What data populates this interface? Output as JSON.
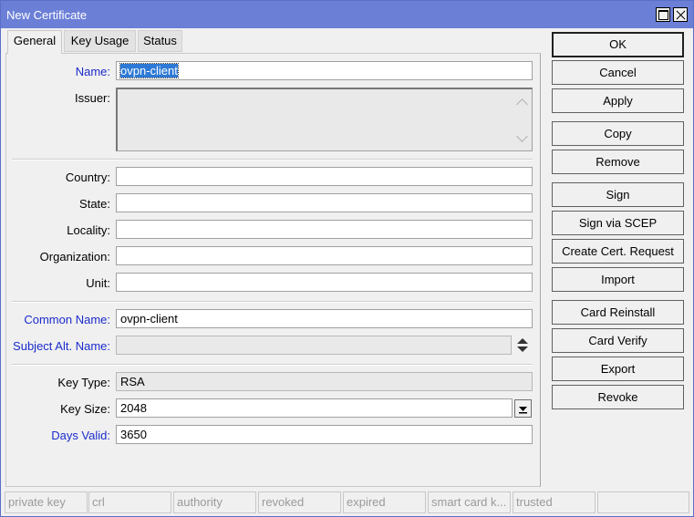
{
  "window": {
    "title": "New Certificate"
  },
  "tabs": [
    {
      "label": "General"
    },
    {
      "label": "Key Usage"
    },
    {
      "label": "Status"
    }
  ],
  "form": {
    "name": {
      "label": "Name:",
      "value": "ovpn-client"
    },
    "issuer": {
      "label": "Issuer:",
      "value": ""
    },
    "country": {
      "label": "Country:",
      "value": ""
    },
    "state": {
      "label": "State:",
      "value": ""
    },
    "locality": {
      "label": "Locality:",
      "value": ""
    },
    "organization": {
      "label": "Organization:",
      "value": ""
    },
    "unit": {
      "label": "Unit:",
      "value": ""
    },
    "common_name": {
      "label": "Common Name:",
      "value": "ovpn-client"
    },
    "subject_alt_name": {
      "label": "Subject Alt. Name:",
      "value": ""
    },
    "key_type": {
      "label": "Key Type:",
      "value": "RSA"
    },
    "key_size": {
      "label": "Key Size:",
      "value": "2048"
    },
    "days_valid": {
      "label": "Days Valid:",
      "value": "3650"
    }
  },
  "buttons": {
    "ok": "OK",
    "cancel": "Cancel",
    "apply": "Apply",
    "copy": "Copy",
    "remove": "Remove",
    "sign": "Sign",
    "sign_scep": "Sign via SCEP",
    "create_request": "Create Cert. Request",
    "import": "Import",
    "card_reinstall": "Card Reinstall",
    "card_verify": "Card Verify",
    "export": "Export",
    "revoke": "Revoke"
  },
  "status_bar": [
    "private key",
    "crl",
    "authority",
    "revoked",
    "expired",
    "smart card k...",
    "trusted",
    ""
  ],
  "colors": {
    "titlebar": "#6b7fd7",
    "link_label": "#1a2bcc",
    "selection": "#2d79d6"
  }
}
